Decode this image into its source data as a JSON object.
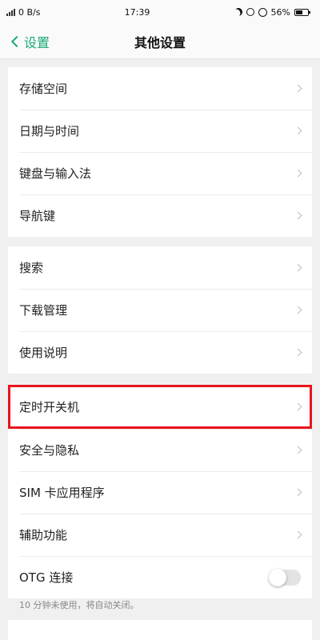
{
  "status_bar": {
    "network_speed": "0 B/s",
    "time": "17:39",
    "battery_percent": "56%",
    "battery_level": 0.56
  },
  "nav": {
    "back_label": "设置",
    "title": "其他设置"
  },
  "groups": [
    {
      "items": [
        {
          "label": "存储空间"
        },
        {
          "label": "日期与时间"
        },
        {
          "label": "键盘与输入法"
        },
        {
          "label": "导航键"
        }
      ]
    },
    {
      "items": [
        {
          "label": "搜索"
        },
        {
          "label": "下载管理"
        },
        {
          "label": "使用说明"
        }
      ]
    },
    {
      "items": [
        {
          "label": "定时开关机",
          "highlighted": true
        },
        {
          "label": "安全与隐私"
        },
        {
          "label": "SIM 卡应用程序"
        },
        {
          "label": "辅助功能"
        },
        {
          "label": "OTG 连接",
          "toggle": false
        }
      ]
    }
  ],
  "footnote": "10 分钟未使用，将自动关闭。",
  "colors": {
    "accent": "#19a974",
    "highlight": "#e8141e"
  },
  "icons": [
    "signal-icon",
    "moon-icon",
    "sync-icon",
    "alarm-icon",
    "battery-icon",
    "chevron-left-icon",
    "chevron-right-icon"
  ]
}
